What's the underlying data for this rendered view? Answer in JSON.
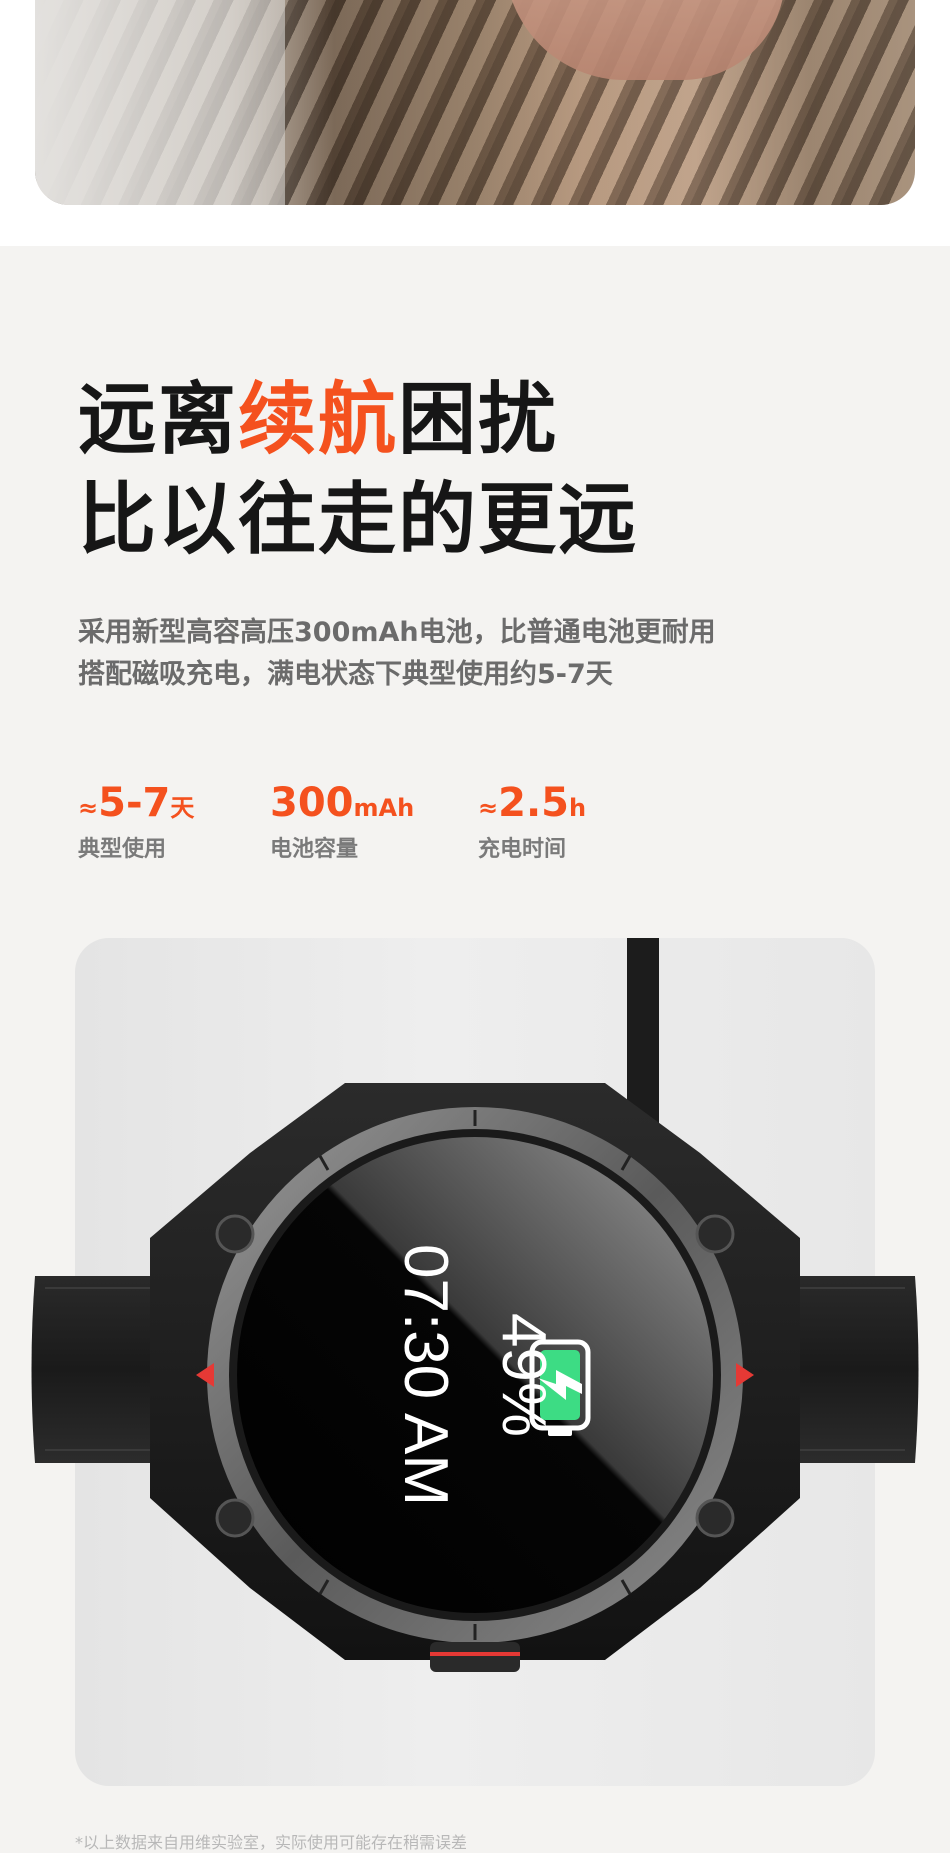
{
  "headline": {
    "line1_prefix": "远离",
    "line1_accent": "续航",
    "line1_suffix": "困扰",
    "line2": "比以往走的更远"
  },
  "description": {
    "line1": "采用新型高容高压300mAh电池，比普通电池更耐用",
    "line2": "搭配磁吸充电，满电状态下典型使用约5-7天"
  },
  "stats": [
    {
      "prefix": "≈",
      "value": "5-7",
      "unit": "天",
      "label": "典型使用"
    },
    {
      "prefix": "",
      "value": "300",
      "unit": "mAh",
      "label": "电池容量"
    },
    {
      "prefix": "≈",
      "value": "2.5",
      "unit": "h",
      "label": "充电时间"
    }
  ],
  "watch_screen": {
    "battery_percent": "49%",
    "time": "07:30 AM",
    "icon": "battery-charging-icon"
  },
  "footnote": "*以上数据来自用维实验室，实际使用可能存在稍需误差",
  "colors": {
    "accent": "#f4511e",
    "text_dark": "#161616",
    "text_gray": "#6b6b6b",
    "panel_bg": "#f4f3f1",
    "battery_green": "#3ddc84"
  }
}
